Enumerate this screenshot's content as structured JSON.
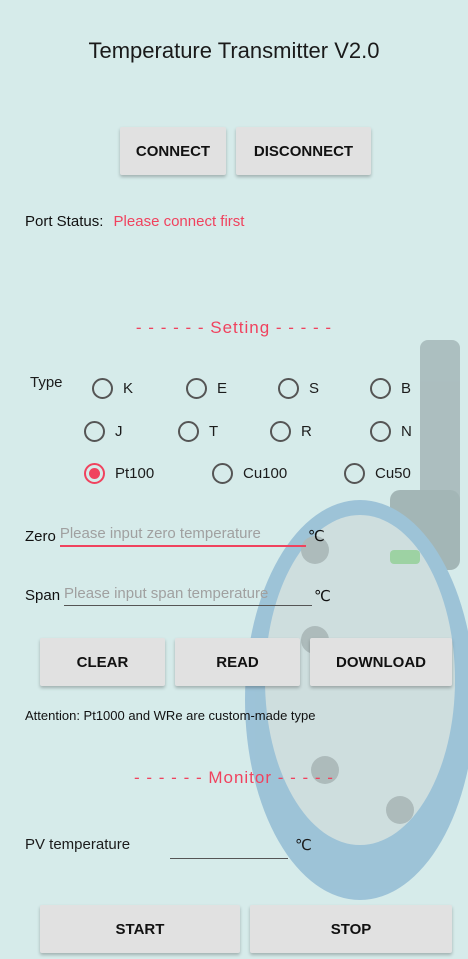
{
  "title": "Temperature Transmitter V2.0",
  "connection": {
    "connect_label": "CONNECT",
    "disconnect_label": "DISCONNECT"
  },
  "port_status": {
    "label": "Port Status:",
    "value": "Please connect first"
  },
  "setting": {
    "divider": "- - - - - - Setting - - - - -",
    "type_label": "Type",
    "types": [
      "K",
      "E",
      "S",
      "B",
      "J",
      "T",
      "R",
      "N",
      "Pt100",
      "Cu100",
      "Cu50"
    ],
    "selected_type": "Pt100",
    "zero": {
      "label": "Zero",
      "placeholder": "Please input zero temperature",
      "unit": "℃"
    },
    "span": {
      "label": "Span",
      "placeholder": "Please input span temperature",
      "unit": "℃"
    },
    "clear_label": "CLEAR",
    "read_label": "READ",
    "download_label": "DOWNLOAD",
    "attention": "Attention: Pt1000 and WRe are custom-made type"
  },
  "monitor": {
    "divider": "- - - - - - Monitor - - - - -",
    "pv_label": "PV temperature",
    "pv_unit": "℃",
    "start_label": "START",
    "stop_label": "STOP"
  },
  "colors": {
    "background": "#d6ebea",
    "accent": "#f0425e",
    "button": "#e1e1e1"
  }
}
